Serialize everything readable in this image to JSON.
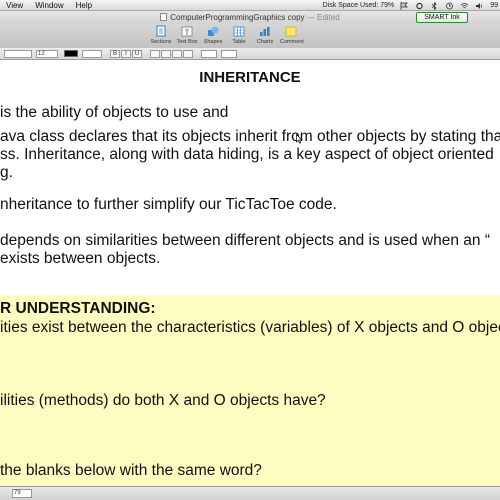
{
  "menubar": {
    "items": [
      "View",
      "Window",
      "Help"
    ],
    "disk_space": "Disk Space Used: 79%",
    "battery": "99"
  },
  "window": {
    "title": "ComputerProgrammingGraphics copy",
    "status": "— Edited",
    "smart_ink": "SMART Ink"
  },
  "toolbar": {
    "tools": [
      "Sections",
      "Text Box",
      "Shapes",
      "Table",
      "Charts",
      "Comment"
    ]
  },
  "formatbar": {
    "font_size": "12",
    "buttons": [
      "B",
      "I",
      "U"
    ]
  },
  "document": {
    "title": "INHERITANCE",
    "lines": [
      "is the ability of objects to use                              and",
      "ava class declares that its objects inherit from other objects by stating that",
      "ss. Inheritance, along with data hiding, is a key aspect of object oriented",
      "g.",
      "nheritance to further simplify our TicTacToe code.",
      "depends on similarities between different objects and is used when an “",
      "exists between objects."
    ],
    "section_heading": "R UNDERSTANDING:",
    "questions": [
      "ities exist between the characteristics (variables) of X objects and O objec",
      "ilities (methods) do both X and O objects have?",
      " the blanks below with the same word?"
    ]
  },
  "statusbar": {
    "page": "79"
  }
}
